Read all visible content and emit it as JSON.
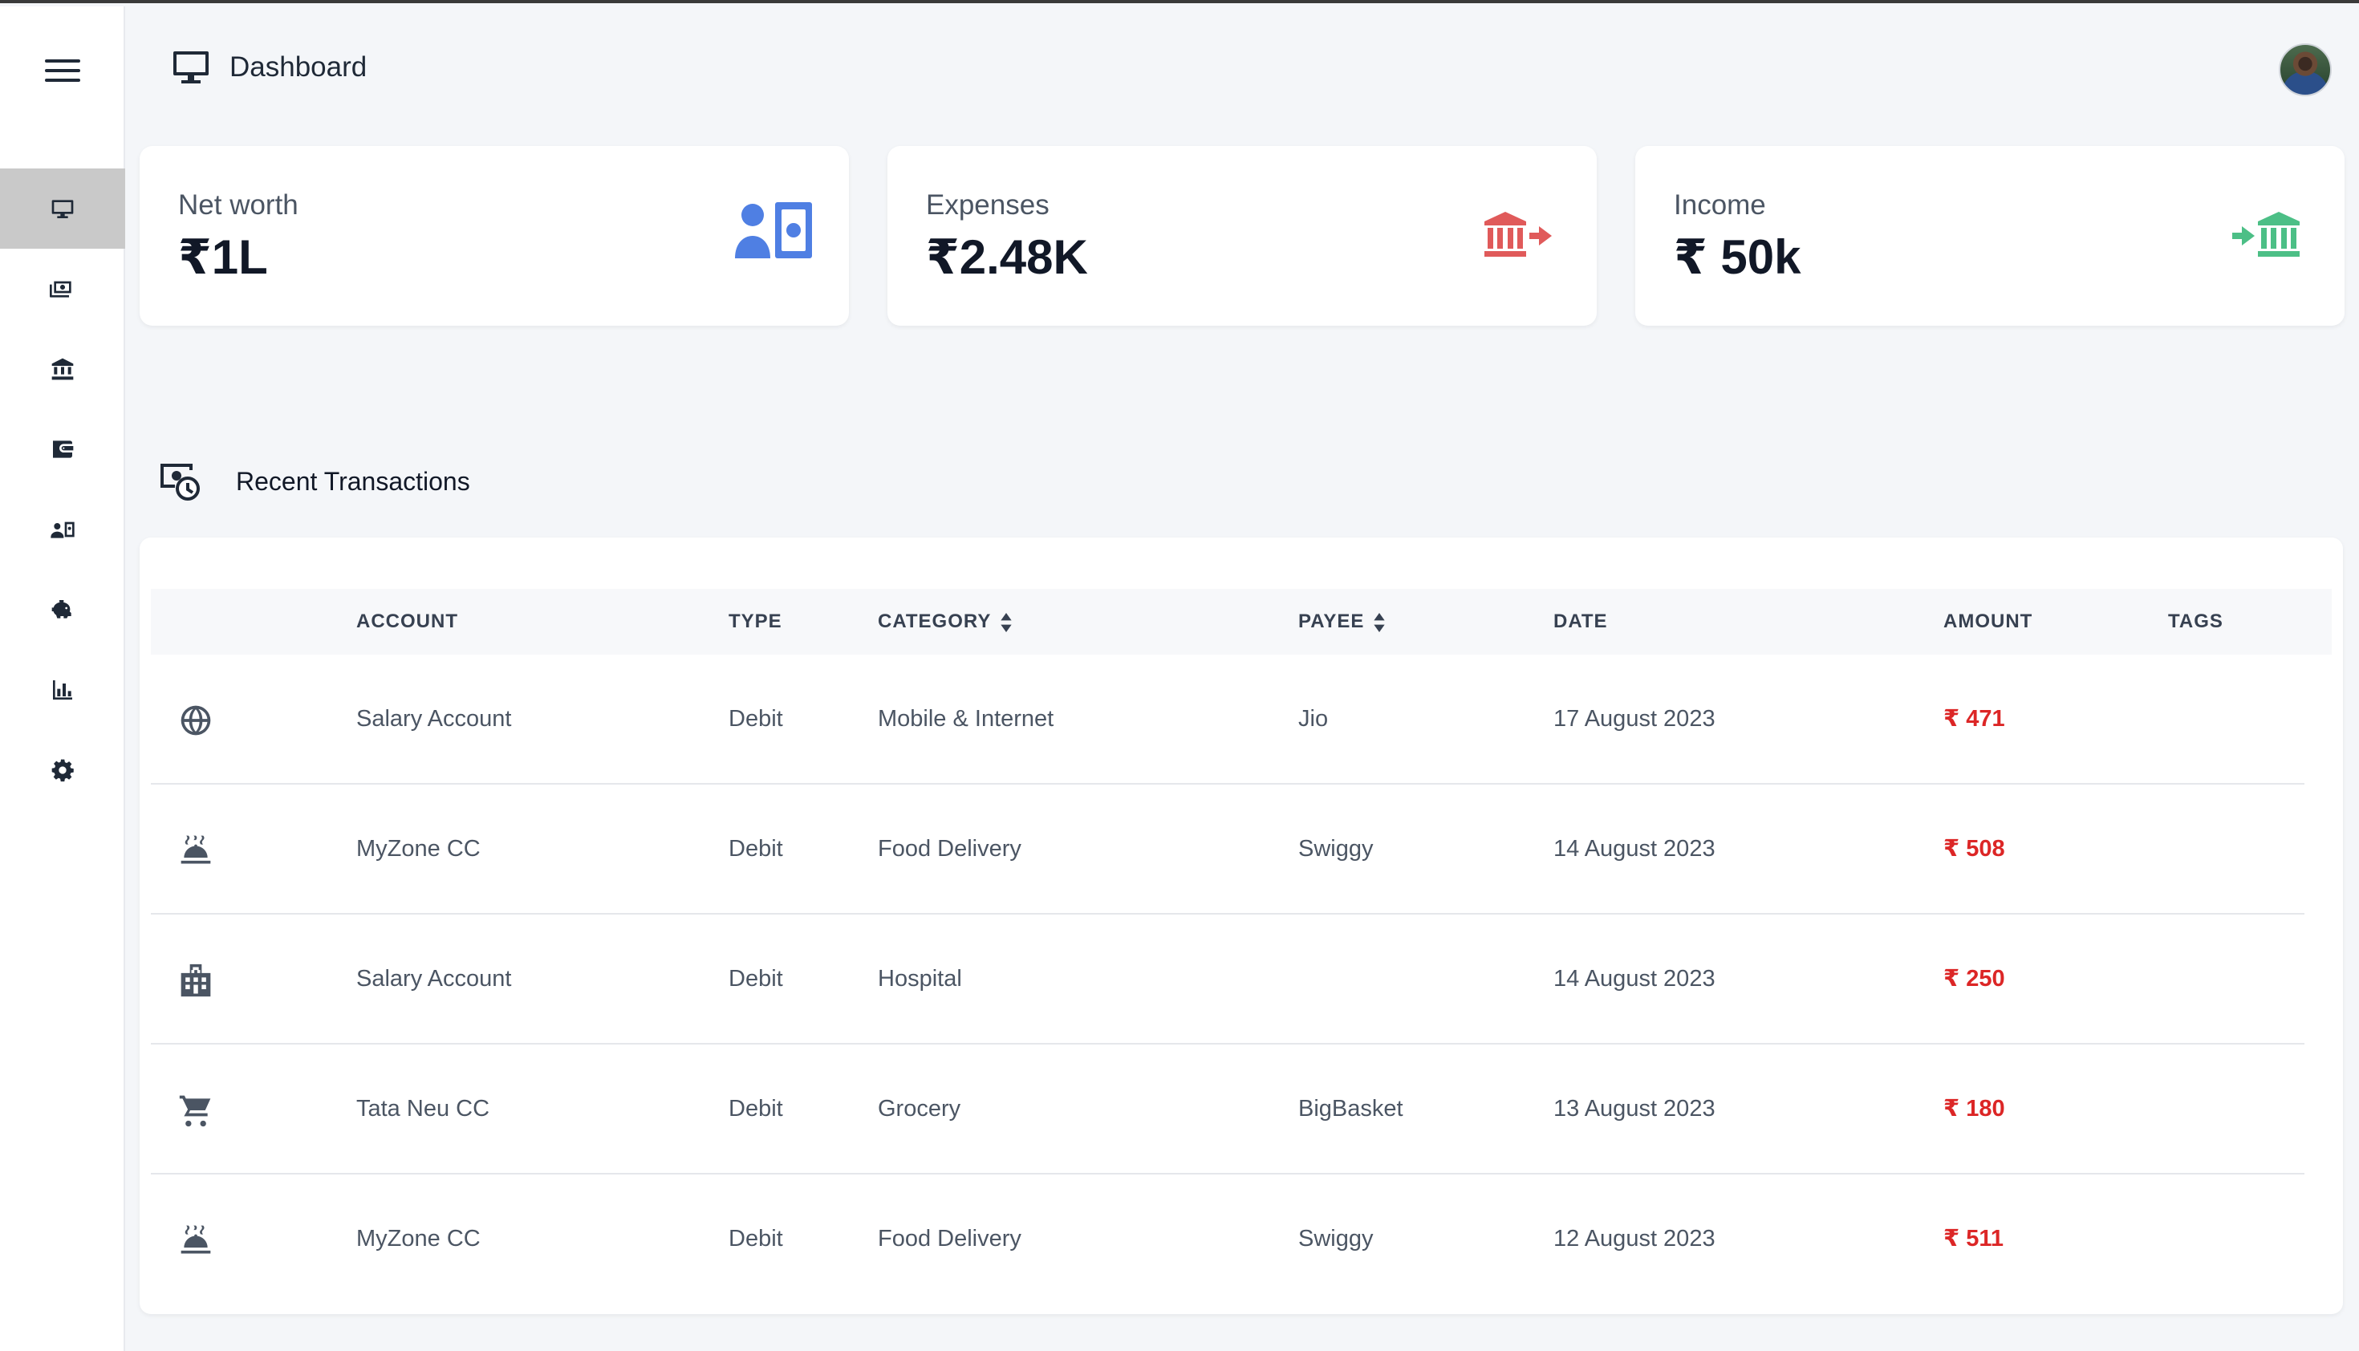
{
  "header": {
    "title": "Dashboard"
  },
  "cards": [
    {
      "label": "Net worth",
      "value": "₹1L",
      "icon": "person-money-icon",
      "color": "#4f7fe3"
    },
    {
      "label": "Expenses",
      "value": "₹2.48K",
      "icon": "bank-outflow-icon",
      "color": "#e05a5a"
    },
    {
      "label": "Income",
      "value": "₹ 50k",
      "icon": "bank-inflow-icon",
      "color": "#4cbf86"
    }
  ],
  "sidebar": {
    "items": [
      {
        "name": "dashboard",
        "icon": "monitor-icon",
        "active": true
      },
      {
        "name": "transactions",
        "icon": "money-icon"
      },
      {
        "name": "accounts",
        "icon": "bank-icon"
      },
      {
        "name": "wallets",
        "icon": "wallet-icon"
      },
      {
        "name": "payees",
        "icon": "person-card-icon"
      },
      {
        "name": "budgets",
        "icon": "piggy-bank-icon"
      },
      {
        "name": "reports",
        "icon": "bar-chart-icon"
      },
      {
        "name": "settings",
        "icon": "gear-icon"
      }
    ]
  },
  "recent": {
    "title": "Recent Transactions",
    "columns": [
      "ACCOUNT",
      "TYPE",
      "CATEGORY",
      "PAYEE",
      "DATE",
      "AMOUNT",
      "TAGS"
    ],
    "rows": [
      {
        "icon": "globe-icon",
        "account": "Salary Account",
        "type": "Debit",
        "category": "Mobile & Internet",
        "payee": "Jio",
        "date": "17 August 2023",
        "amount": "₹ 471",
        "tags": ""
      },
      {
        "icon": "food-delivery-icon",
        "account": "MyZone CC",
        "type": "Debit",
        "category": "Food Delivery",
        "payee": "Swiggy",
        "date": "14 August 2023",
        "amount": "₹ 508",
        "tags": ""
      },
      {
        "icon": "hospital-icon",
        "account": "Salary Account",
        "type": "Debit",
        "category": "Hospital",
        "payee": "",
        "date": "14 August 2023",
        "amount": "₹ 250",
        "tags": ""
      },
      {
        "icon": "cart-icon",
        "account": "Tata Neu CC",
        "type": "Debit",
        "category": "Grocery",
        "payee": "BigBasket",
        "date": "13 August 2023",
        "amount": "₹ 180",
        "tags": ""
      },
      {
        "icon": "food-delivery-icon",
        "account": "MyZone CC",
        "type": "Debit",
        "category": "Food Delivery",
        "payee": "Swiggy",
        "date": "12 August 2023",
        "amount": "₹ 511",
        "tags": ""
      }
    ]
  }
}
